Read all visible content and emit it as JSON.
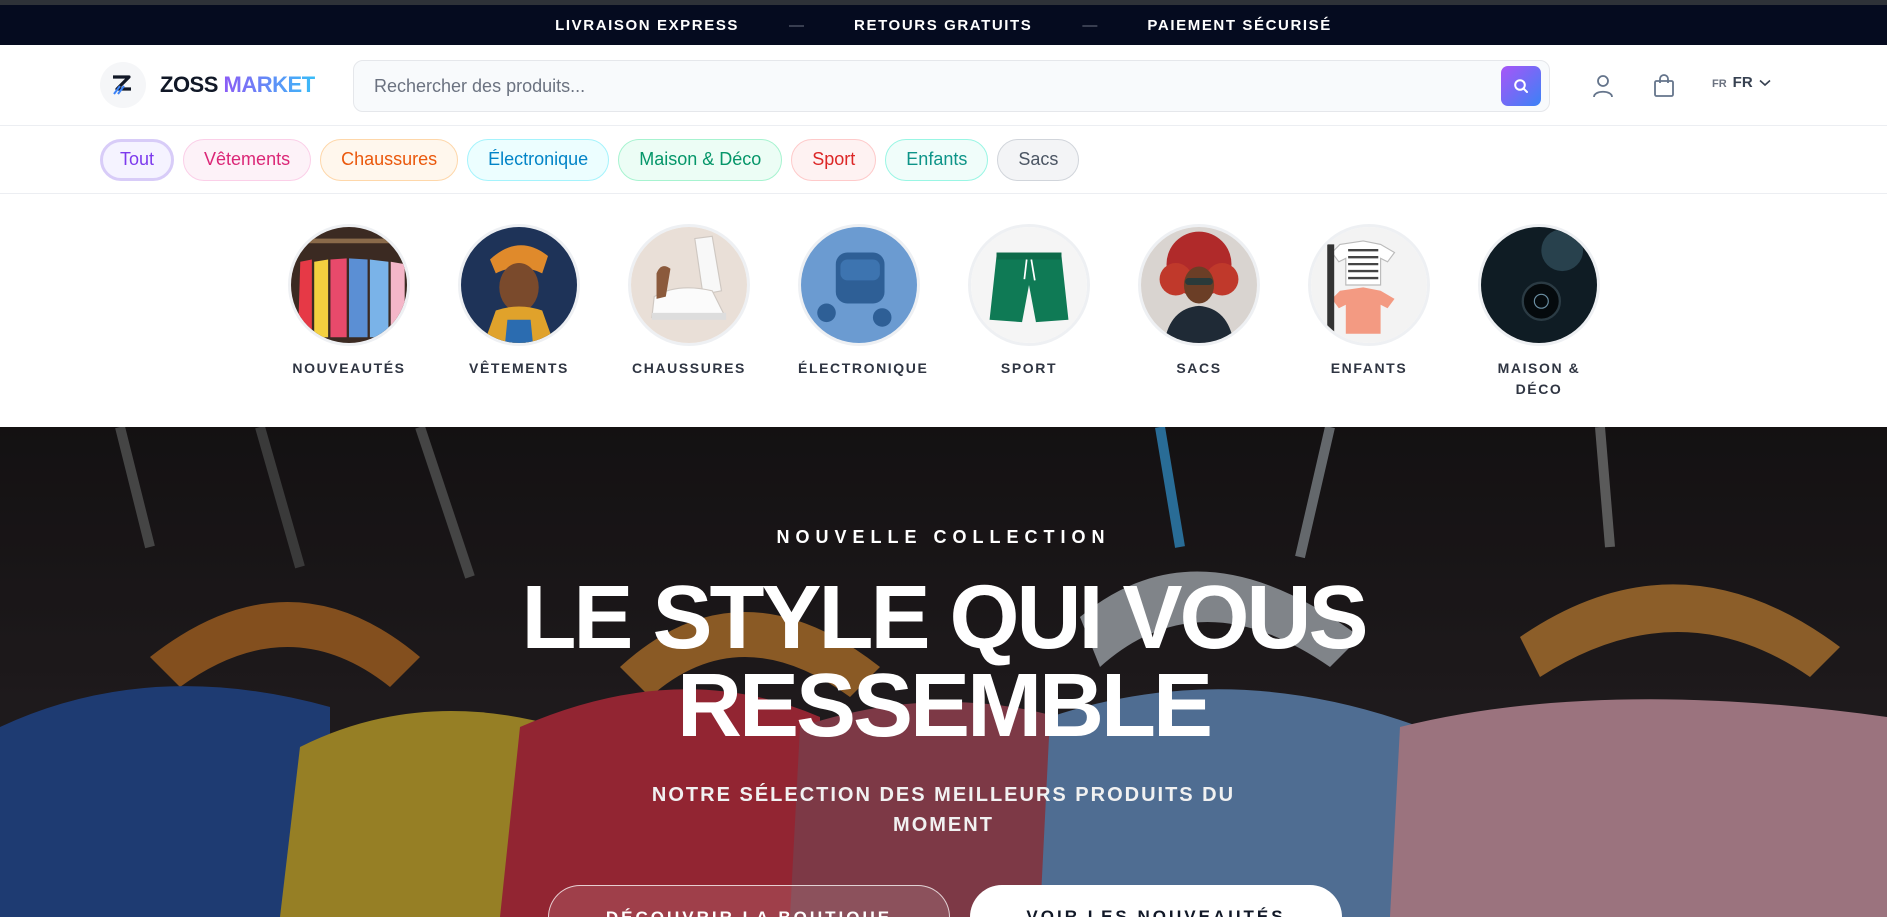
{
  "announcement": {
    "items": [
      "LIVRAISON EXPRESS",
      "RETOURS GRATUITS",
      "PAIEMENT SÉCURISÉ"
    ],
    "separator": "—"
  },
  "header": {
    "brand_part1": "ZOSS",
    "brand_part2": "MARKET",
    "search": {
      "placeholder": "Rechercher des produits..."
    },
    "language": {
      "small": "FR",
      "label": "FR"
    }
  },
  "categories": [
    {
      "label": "Tout",
      "active": true
    },
    {
      "label": "Vêtements"
    },
    {
      "label": "Chaussures"
    },
    {
      "label": "Électronique"
    },
    {
      "label": "Maison & Déco"
    },
    {
      "label": "Sport"
    },
    {
      "label": "Enfants"
    },
    {
      "label": "Sacs"
    }
  ],
  "circle_categories": [
    {
      "label": "NOUVEAUTÉS"
    },
    {
      "label": "VÊTEMENTS"
    },
    {
      "label": "CHAUSSURES"
    },
    {
      "label": "ÉLECTRONIQUE"
    },
    {
      "label": "SPORT"
    },
    {
      "label": "SACS"
    },
    {
      "label": "ENFANTS"
    },
    {
      "label": "MAISON & DÉCO"
    }
  ],
  "hero": {
    "eyebrow": "NOUVELLE COLLECTION",
    "title_line1": "LE STYLE QUI VOUS",
    "title_line2": "RESSEMBLE",
    "subtitle": "NOTRE SÉLECTION DES MEILLEURS PRODUITS DU MOMENT",
    "primary_button": "DÉCOUVRIR LA BOUTIQUE",
    "secondary_button": "VOIR LES NOUVEAUTÉS"
  },
  "colors": {
    "topbar_bg": "#050b1f",
    "accent_gradient_start": "#a855f7",
    "accent_gradient_end": "#3b82f6"
  }
}
